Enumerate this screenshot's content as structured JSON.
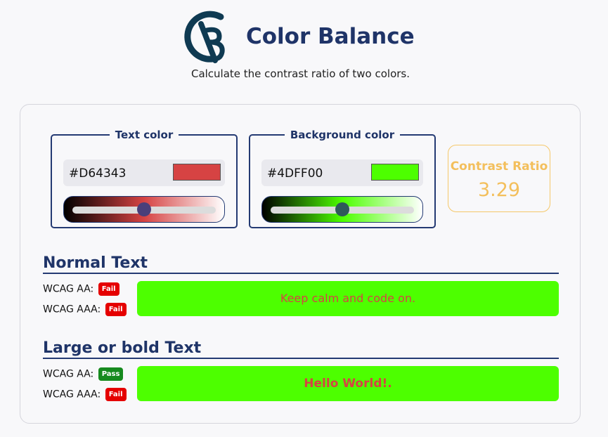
{
  "app": {
    "title": "Color Balance",
    "subtitle": "Calculate the contrast ratio of two colors.",
    "logo_color": "#0f3a52"
  },
  "text_color": {
    "legend": "Text color",
    "hex": "#D64343",
    "swatch": "#D64343",
    "slider_position": 0.5
  },
  "background_color": {
    "legend": "Background color",
    "hex": "#4DFF00",
    "swatch": "#4DFF00",
    "slider_position": 0.5
  },
  "contrast": {
    "label": "Contrast Ratio",
    "value": "3.29"
  },
  "normal_text": {
    "heading": "Normal Text",
    "aa_label": "WCAG AA:",
    "aa_result": "Fail",
    "aaa_label": "WCAG AAA:",
    "aaa_result": "Fail",
    "preview_text": "Keep calm and code on."
  },
  "large_text": {
    "heading": "Large or bold Text",
    "aa_label": "WCAG AA:",
    "aa_result": "Pass",
    "aaa_label": "WCAG AAA:",
    "aaa_result": "Fail",
    "preview_text": "Hello World!."
  },
  "colors": {
    "accent": "#1f3468",
    "ratio": "#f3bf5c",
    "fail": "#e50000",
    "pass": "#168a1e"
  }
}
